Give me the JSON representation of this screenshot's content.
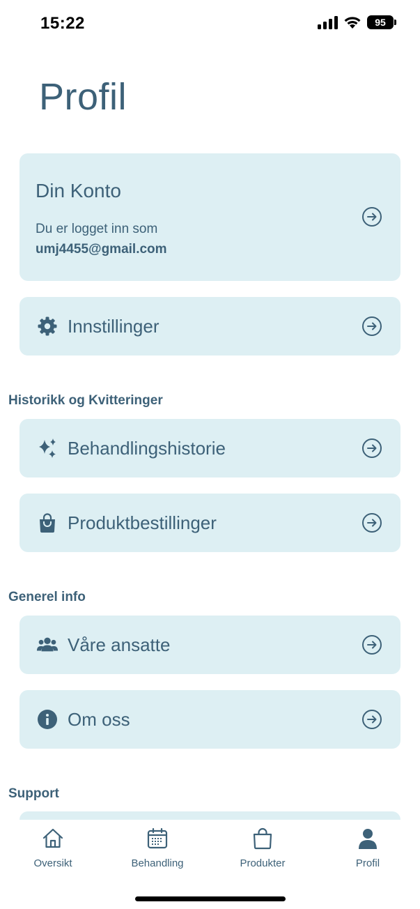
{
  "status_bar": {
    "time": "15:22",
    "battery": "95"
  },
  "page": {
    "title": "Profil"
  },
  "account": {
    "title": "Din Konto",
    "subtitle": "Du er logget inn som",
    "email": "umj4455@gmail.com"
  },
  "settings": {
    "label": "Innstillinger"
  },
  "sections": {
    "history": {
      "title": "Historikk og Kvitteringer",
      "items": [
        {
          "label": "Behandlingshistorie",
          "icon": "sparkles-icon"
        },
        {
          "label": "Produktbestillinger",
          "icon": "shopping-bag-icon"
        }
      ]
    },
    "general": {
      "title": "Generel info",
      "items": [
        {
          "label": "Våre ansatte",
          "icon": "users-icon"
        },
        {
          "label": "Om oss",
          "icon": "info-icon"
        }
      ]
    },
    "support": {
      "title": "Support"
    }
  },
  "tabs": [
    {
      "label": "Oversikt",
      "icon": "home-icon"
    },
    {
      "label": "Behandling",
      "icon": "calendar-icon"
    },
    {
      "label": "Produkter",
      "icon": "bag-icon"
    },
    {
      "label": "Profil",
      "icon": "person-icon"
    }
  ],
  "colors": {
    "accent": "#3d6178",
    "card": "#ddeff3"
  }
}
